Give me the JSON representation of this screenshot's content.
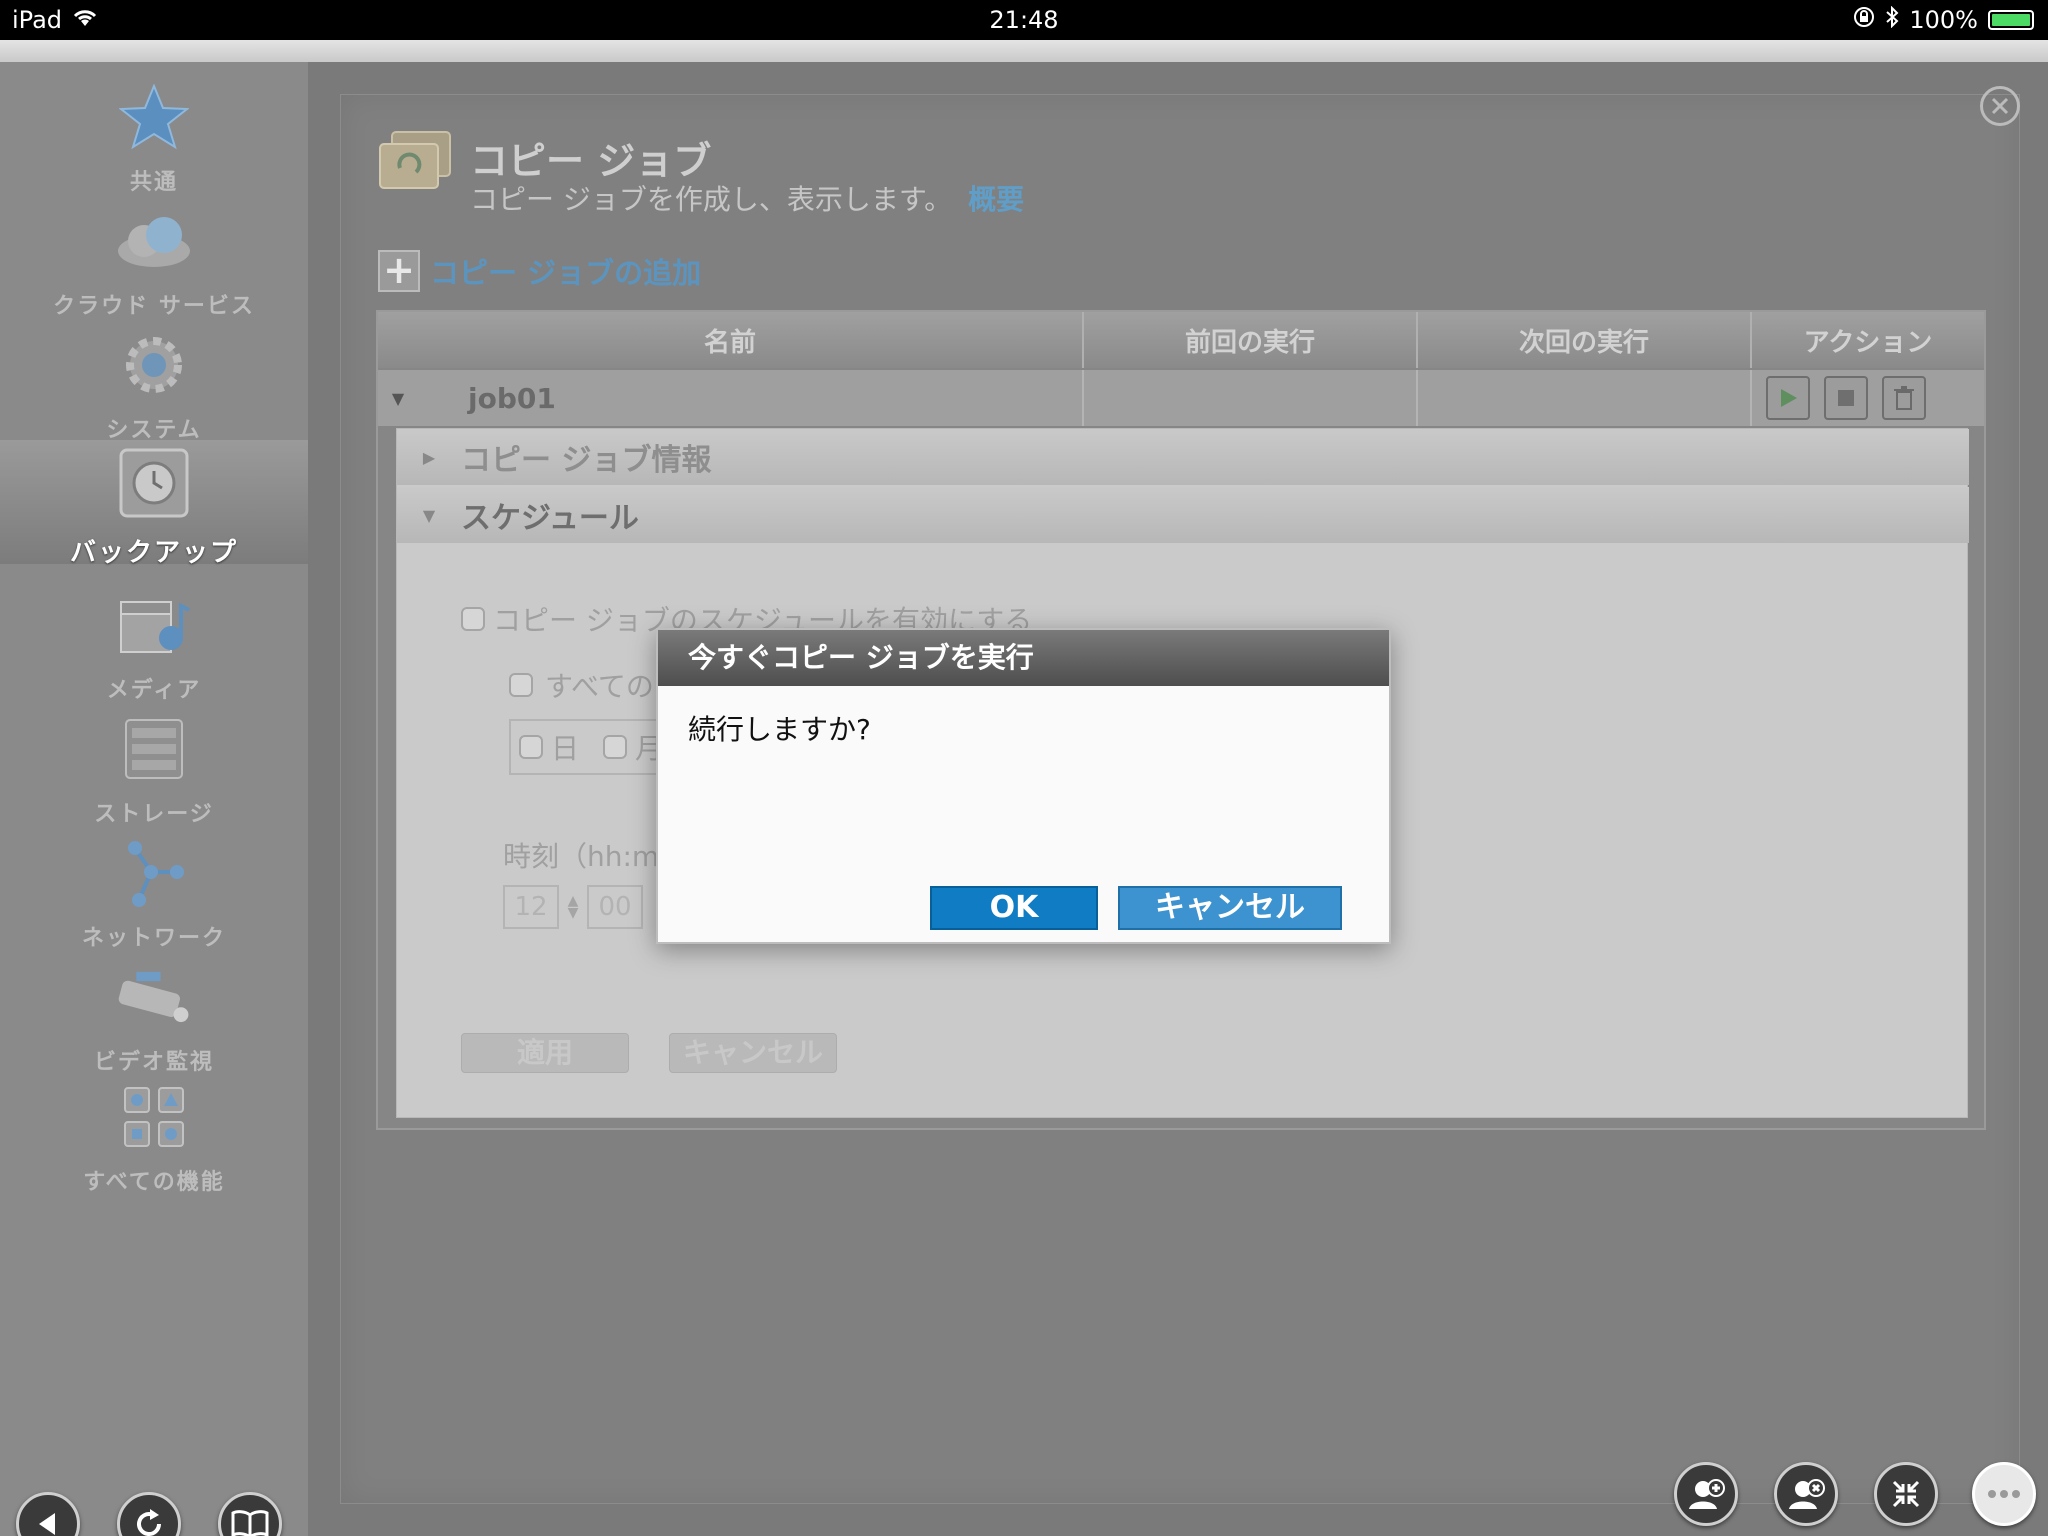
{
  "status_bar": {
    "device": "iPad",
    "time": "21:48",
    "battery": "100%"
  },
  "sidebar": {
    "items": [
      {
        "label": "共通",
        "icon": "star-icon"
      },
      {
        "label": "クラウド サービス",
        "icon": "cloud-icon"
      },
      {
        "label": "システム",
        "icon": "gear-icon"
      },
      {
        "label": "バックアップ",
        "icon": "backup-safe-icon",
        "active": true
      },
      {
        "label": "メディア",
        "icon": "media-clapper-icon"
      },
      {
        "label": "ストレージ",
        "icon": "storage-server-icon"
      },
      {
        "label": "ネットワーク",
        "icon": "network-nodes-icon"
      },
      {
        "label": "ビデオ監視",
        "icon": "security-camera-icon"
      },
      {
        "label": "すべての機能",
        "icon": "all-features-grid-icon"
      }
    ]
  },
  "page": {
    "title": "コピー ジョブ",
    "description": "コピー ジョブを作成し、表示します。",
    "overview_link": "概要",
    "add_job_label": "コピー ジョブの追加"
  },
  "table": {
    "columns": [
      "名前",
      "前回の実行",
      "次回の実行",
      "アクション"
    ],
    "rows": [
      {
        "name": "job01",
        "last_run": "",
        "next_run": ""
      }
    ]
  },
  "detail": {
    "sections": [
      {
        "label": "コピー ジョブ情報",
        "expanded": false
      },
      {
        "label": "スケジュール",
        "expanded": true
      }
    ],
    "enable_schedule_label": "コピー ジョブのスケジュールを有効にする",
    "all_days_label": "すべての",
    "day_sun": "日",
    "day_mon": "月",
    "time_label": "時刻（hh:m",
    "hour_value": "12",
    "minute_value": "00",
    "apply_label": "適用",
    "cancel_label": "キャンセル"
  },
  "dialog": {
    "title": "今すぐコピー ジョブを実行",
    "message": "続行しますか?",
    "ok_label": "OK",
    "cancel_label": "キャンセル"
  },
  "colors": {
    "accent": "#0f7cc3",
    "link": "#5f9ec9"
  }
}
